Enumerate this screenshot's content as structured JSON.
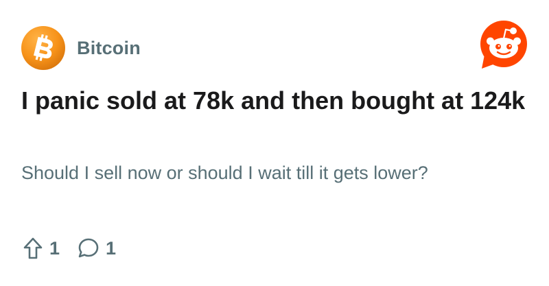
{
  "community": {
    "name": "Bitcoin",
    "icon": "bitcoin-icon",
    "color": "#f7931a"
  },
  "brand": {
    "icon": "reddit-icon",
    "color": "#ff4500"
  },
  "post": {
    "title": "I panic sold at 78k and then bought at 124k",
    "body": "Should I sell now or should I wait till it gets lower?",
    "upvotes": "1",
    "comments": "1"
  },
  "icons": {
    "upvote": "upvote-arrow-icon",
    "comment": "comment-bubble-icon"
  }
}
